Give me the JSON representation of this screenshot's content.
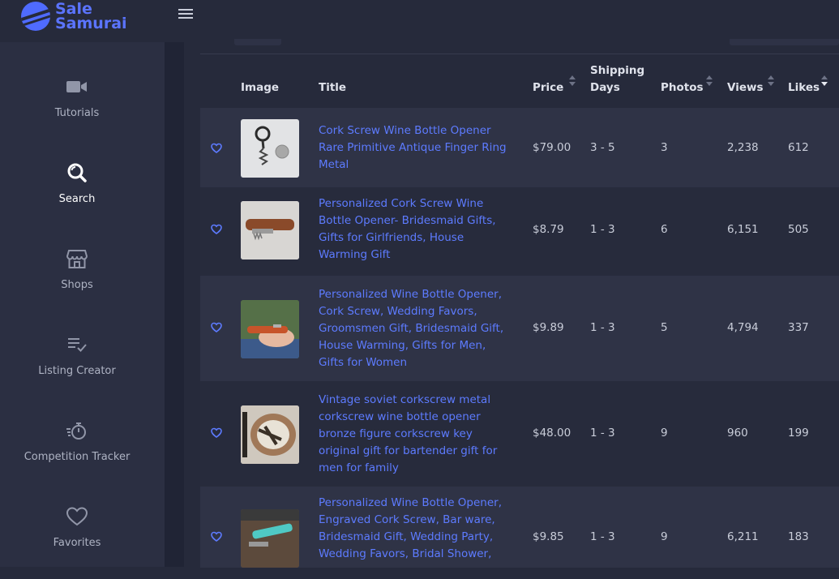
{
  "app": {
    "logo_line1": "Sale",
    "logo_line2": "Samurai"
  },
  "sidebar": {
    "items": [
      {
        "label": "Tutorials",
        "icon": "video-camera-icon",
        "active": false
      },
      {
        "label": "Search",
        "icon": "search-icon",
        "active": true
      },
      {
        "label": "Shops",
        "icon": "store-icon",
        "active": false
      },
      {
        "label": "Listing Creator",
        "icon": "list-check-icon",
        "active": false
      },
      {
        "label": "Competition Tracker",
        "icon": "stopwatch-icon",
        "active": false
      },
      {
        "label": "Favorites",
        "icon": "heart-icon",
        "active": false
      }
    ]
  },
  "table": {
    "headers": {
      "image": "Image",
      "title": "Title",
      "price": "Price",
      "shipping_line1": "Shipping",
      "shipping_line2": "Days",
      "photos": "Photos",
      "views": "Views",
      "likes": "Likes"
    },
    "sort": {
      "column": "Likes",
      "direction": "descending"
    },
    "rows": [
      {
        "title": "Cork Screw Wine Bottle Opener Rare Primitive Antique Finger Ring Metal",
        "price": "$79.00",
        "shipping": "3 - 5",
        "photos": "3",
        "views": "2,238",
        "likes": "612"
      },
      {
        "title": "Personalized Cork Screw Wine Bottle Opener- Bridesmaid Gifts, Gifts for Girlfriends, House Warming Gift",
        "price": "$8.79",
        "shipping": "1 - 3",
        "photos": "6",
        "views": "6,151",
        "likes": "505"
      },
      {
        "title": "Personalized Wine Bottle Opener, Cork Screw, Wedding Favors, Groomsmen Gift, Bridesmaid Gift, House Warming, Gifts for Men, Gifts for Women",
        "price": "$9.89",
        "shipping": "1 - 3",
        "photos": "5",
        "views": "4,794",
        "likes": "337"
      },
      {
        "title": "Vintage soviet corkscrew metal corkscrew wine bottle opener bronze figure corkscrew key original gift for bartender gift for men for family",
        "price": "$48.00",
        "shipping": "1 - 3",
        "photos": "9",
        "views": "960",
        "likes": "199"
      },
      {
        "title": "Personalized Wine Bottle Opener, Engraved Cork Screw, Bar ware, Bridesmaid Gift, Wedding Party, Wedding Favors, Bridal Shower,",
        "price": "$9.85",
        "shipping": "1 - 3",
        "photos": "9",
        "views": "6,211",
        "likes": "183"
      }
    ]
  },
  "colors": {
    "accent": "#5d7bff",
    "background": "#262a3b",
    "sidebar": "#2b2f42"
  }
}
